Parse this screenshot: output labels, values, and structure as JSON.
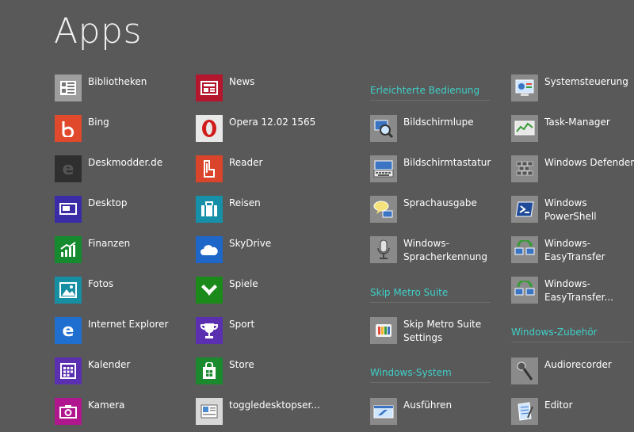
{
  "page": {
    "title": "Apps"
  },
  "columns": [
    {
      "items": [
        {
          "label": "Bibliotheken",
          "icon": "libraries-icon",
          "color": "#9e9e9e"
        },
        {
          "label": "Bing",
          "icon": "bing-icon",
          "color": "#e0492c"
        },
        {
          "label": "Deskmodder.de",
          "icon": "ie-shortcut-icon",
          "color": "#2f2f2f"
        },
        {
          "label": "Desktop",
          "icon": "desktop-icon",
          "color": "#3a2ba6"
        },
        {
          "label": "Finanzen",
          "icon": "finance-icon",
          "color": "#168a2e"
        },
        {
          "label": "Fotos",
          "icon": "photos-icon",
          "color": "#168fa3"
        },
        {
          "label": "Internet Explorer",
          "icon": "internet-explorer-icon",
          "color": "#1f6fd1"
        },
        {
          "label": "Kalender",
          "icon": "calendar-icon",
          "color": "#5a2fb0"
        },
        {
          "label": "Kamera",
          "icon": "camera-icon",
          "color": "#b0168d"
        }
      ]
    },
    {
      "items": [
        {
          "label": "News",
          "icon": "news-icon",
          "color": "#b3162d"
        },
        {
          "label": "Opera 12.02 1565",
          "icon": "opera-icon",
          "color": "#e8e8e8"
        },
        {
          "label": "Reader",
          "icon": "reader-icon",
          "color": "#d9442a"
        },
        {
          "label": "Reisen",
          "icon": "travel-icon",
          "color": "#1690a8"
        },
        {
          "label": "SkyDrive",
          "icon": "skydrive-icon",
          "color": "#1e67c8"
        },
        {
          "label": "Spiele",
          "icon": "games-icon",
          "color": "#1b8a1b"
        },
        {
          "label": "Sport",
          "icon": "sport-icon",
          "color": "#5a2fb0"
        },
        {
          "label": "Store",
          "icon": "store-icon",
          "color": "#1b8a2f"
        },
        {
          "label": "toggledesktopser...",
          "icon": "toggle-desktop-icon",
          "color": "#d8d8d8"
        }
      ]
    },
    {
      "groups": [
        {
          "header": "Erleichterte Bedienung",
          "items": [
            {
              "label": "Bildschirmlupe",
              "icon": "magnifier-icon",
              "color": "#8a8a8a"
            },
            {
              "label": "Bildschirmtastatur",
              "icon": "on-screen-keyboard-icon",
              "color": "#8a8a8a"
            },
            {
              "label": "Sprachausgabe",
              "icon": "narrator-icon",
              "color": "#8a8a8a"
            },
            {
              "label": "Windows-\nSpracherkennung",
              "icon": "microphone-icon",
              "color": "#8a8a8a"
            }
          ]
        },
        {
          "header": "Skip Metro Suite",
          "items": [
            {
              "label": "Skip Metro Suite\nSettings",
              "icon": "skip-metro-icon",
              "color": "#8a8a8a"
            }
          ]
        },
        {
          "header": "Windows-System",
          "items": [
            {
              "label": "Ausführen",
              "icon": "run-icon",
              "color": "#8a8a8a"
            }
          ]
        }
      ]
    },
    {
      "groups": [
        {
          "header": "",
          "items": [
            {
              "label": "Systemsteuerung",
              "icon": "control-panel-icon",
              "color": "#8a8a8a"
            },
            {
              "label": "Task-Manager",
              "icon": "task-manager-icon",
              "color": "#8a8a8a"
            },
            {
              "label": "Windows Defender",
              "icon": "windows-defender-icon",
              "color": "#8a8a8a"
            },
            {
              "label": "Windows\nPowerShell",
              "icon": "powershell-icon",
              "color": "#8a8a8a"
            },
            {
              "label": "Windows-\nEasyTransfer",
              "icon": "easy-transfer-icon",
              "color": "#8a8a8a"
            },
            {
              "label": "Windows-\nEasyTransfer...",
              "icon": "easy-transfer-report-icon",
              "color": "#8a8a8a"
            }
          ]
        },
        {
          "header": "Windows-Zubehör",
          "items": [
            {
              "label": "Audiorecorder",
              "icon": "audio-recorder-icon",
              "color": "#8a8a8a"
            },
            {
              "label": "Editor",
              "icon": "notepad-icon",
              "color": "#8a8a8a"
            }
          ]
        }
      ]
    }
  ]
}
